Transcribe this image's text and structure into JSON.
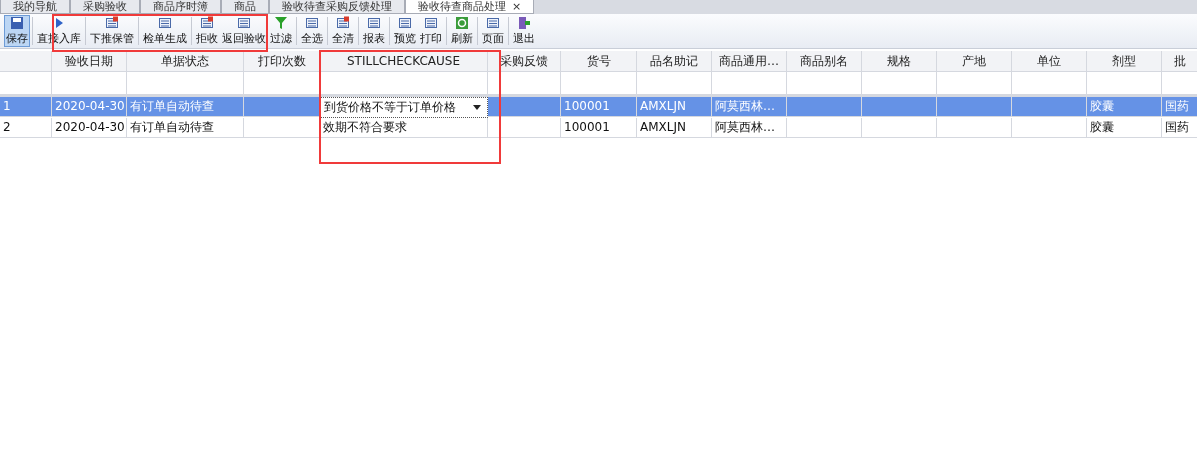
{
  "tabs": [
    {
      "label": "我的导航",
      "selected": false
    },
    {
      "label": "采购验收",
      "selected": false
    },
    {
      "label": "商品序时簿",
      "selected": false
    },
    {
      "label": "商品",
      "selected": false
    },
    {
      "label": "验收待查采购反馈处理",
      "selected": false
    },
    {
      "label": "验收待查商品处理",
      "selected": true,
      "close": "×"
    }
  ],
  "toolbar": [
    {
      "label": "保存",
      "pressed": true
    },
    {
      "label": "直接入库",
      "pressed": false
    },
    {
      "label": "下推保管",
      "pressed": false
    },
    {
      "label": "检单生成",
      "pressed": false
    },
    {
      "label": "拒收",
      "pressed": false
    },
    {
      "label": "返回验收",
      "pressed": false
    },
    {
      "label": "过滤",
      "pressed": false
    },
    {
      "label": "全选",
      "pressed": false
    },
    {
      "label": "全清",
      "pressed": false
    },
    {
      "label": "报表",
      "pressed": false
    },
    {
      "label": "预览",
      "pressed": false
    },
    {
      "label": "打印",
      "pressed": false
    },
    {
      "label": "刷新",
      "pressed": false
    },
    {
      "label": "页面",
      "pressed": false
    },
    {
      "label": "退出",
      "pressed": false
    }
  ],
  "table": {
    "columns": [
      "",
      "验收日期",
      "单据状态",
      "打印次数",
      "STILLCHECKCAUSE",
      "采购反馈",
      "货号",
      "品名助记",
      "商品通用…",
      "商品别名",
      "规格",
      "产地",
      "单位",
      "剂型",
      "批"
    ],
    "rows": [
      {
        "selected": true,
        "editing": true,
        "cells": [
          "1",
          "2020-04-30",
          "有订单自动待查",
          "",
          "到货价格不等于订单价格",
          "",
          "100001",
          "AMXLJN",
          "阿莫西林…",
          "",
          "",
          "",
          "",
          "胶囊",
          "国药"
        ]
      },
      {
        "selected": false,
        "editing": false,
        "cells": [
          "2",
          "2020-04-30",
          "有订单自动待查",
          "",
          "效期不符合要求",
          "",
          "100001",
          "AMXLJN",
          "阿莫西林…",
          "",
          "",
          "",
          "",
          "胶囊",
          "国药"
        ]
      }
    ]
  }
}
